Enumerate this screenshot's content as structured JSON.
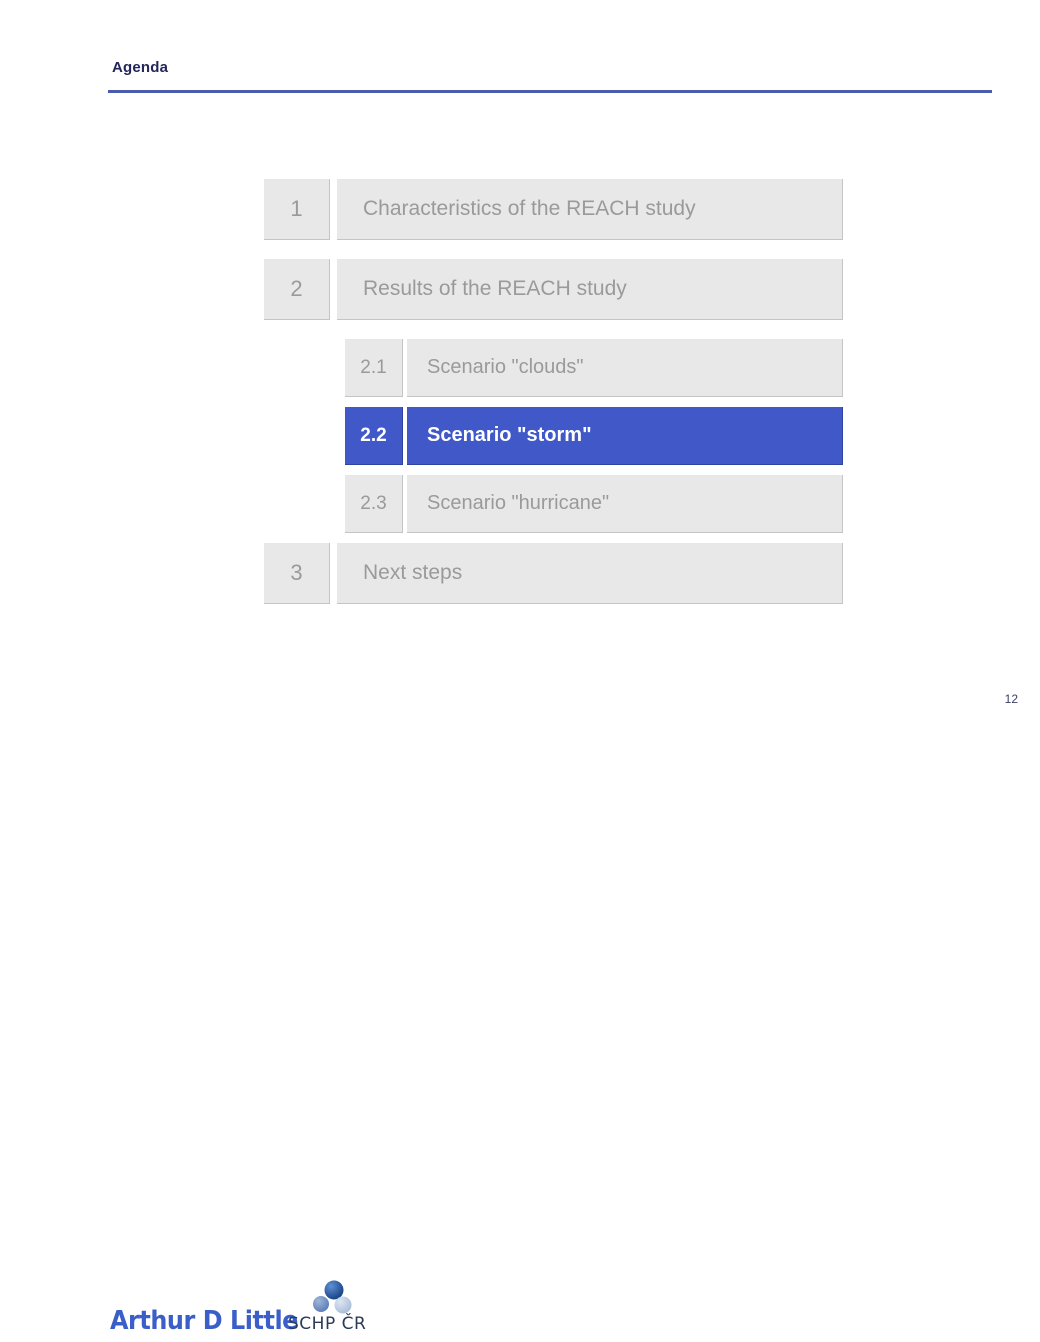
{
  "slide": {
    "title": "Agenda",
    "page_number": "12",
    "accent_color": "#4058c8",
    "rule_color": "#4a5cab",
    "box_color": "#e8e8e8",
    "muted_text_color": "#9a9a9a"
  },
  "agenda": {
    "items": [
      {
        "number": "1",
        "label": "Characteristics of the REACH study",
        "level": "top",
        "active": false
      },
      {
        "number": "2",
        "label": "Results of the REACH study",
        "level": "top",
        "active": false
      },
      {
        "number": "2.1",
        "label": "Scenario \"clouds\"",
        "level": "sub",
        "active": false
      },
      {
        "number": "2.2",
        "label": "Scenario \"storm\"",
        "level": "sub",
        "active": true
      },
      {
        "number": "2.3",
        "label": "Scenario \"hurricane\"",
        "level": "sub",
        "active": false
      },
      {
        "number": "3",
        "label": "Next steps",
        "level": "top",
        "active": false
      }
    ]
  },
  "footer": {
    "logo_primary": "Arthur D Little",
    "logo_secondary": "SCHP ČR",
    "logo_primary_color": "#3a5fc8",
    "sphere_colors": [
      "#1f4e9c",
      "#6f8fc6",
      "#b9c8e0"
    ]
  }
}
